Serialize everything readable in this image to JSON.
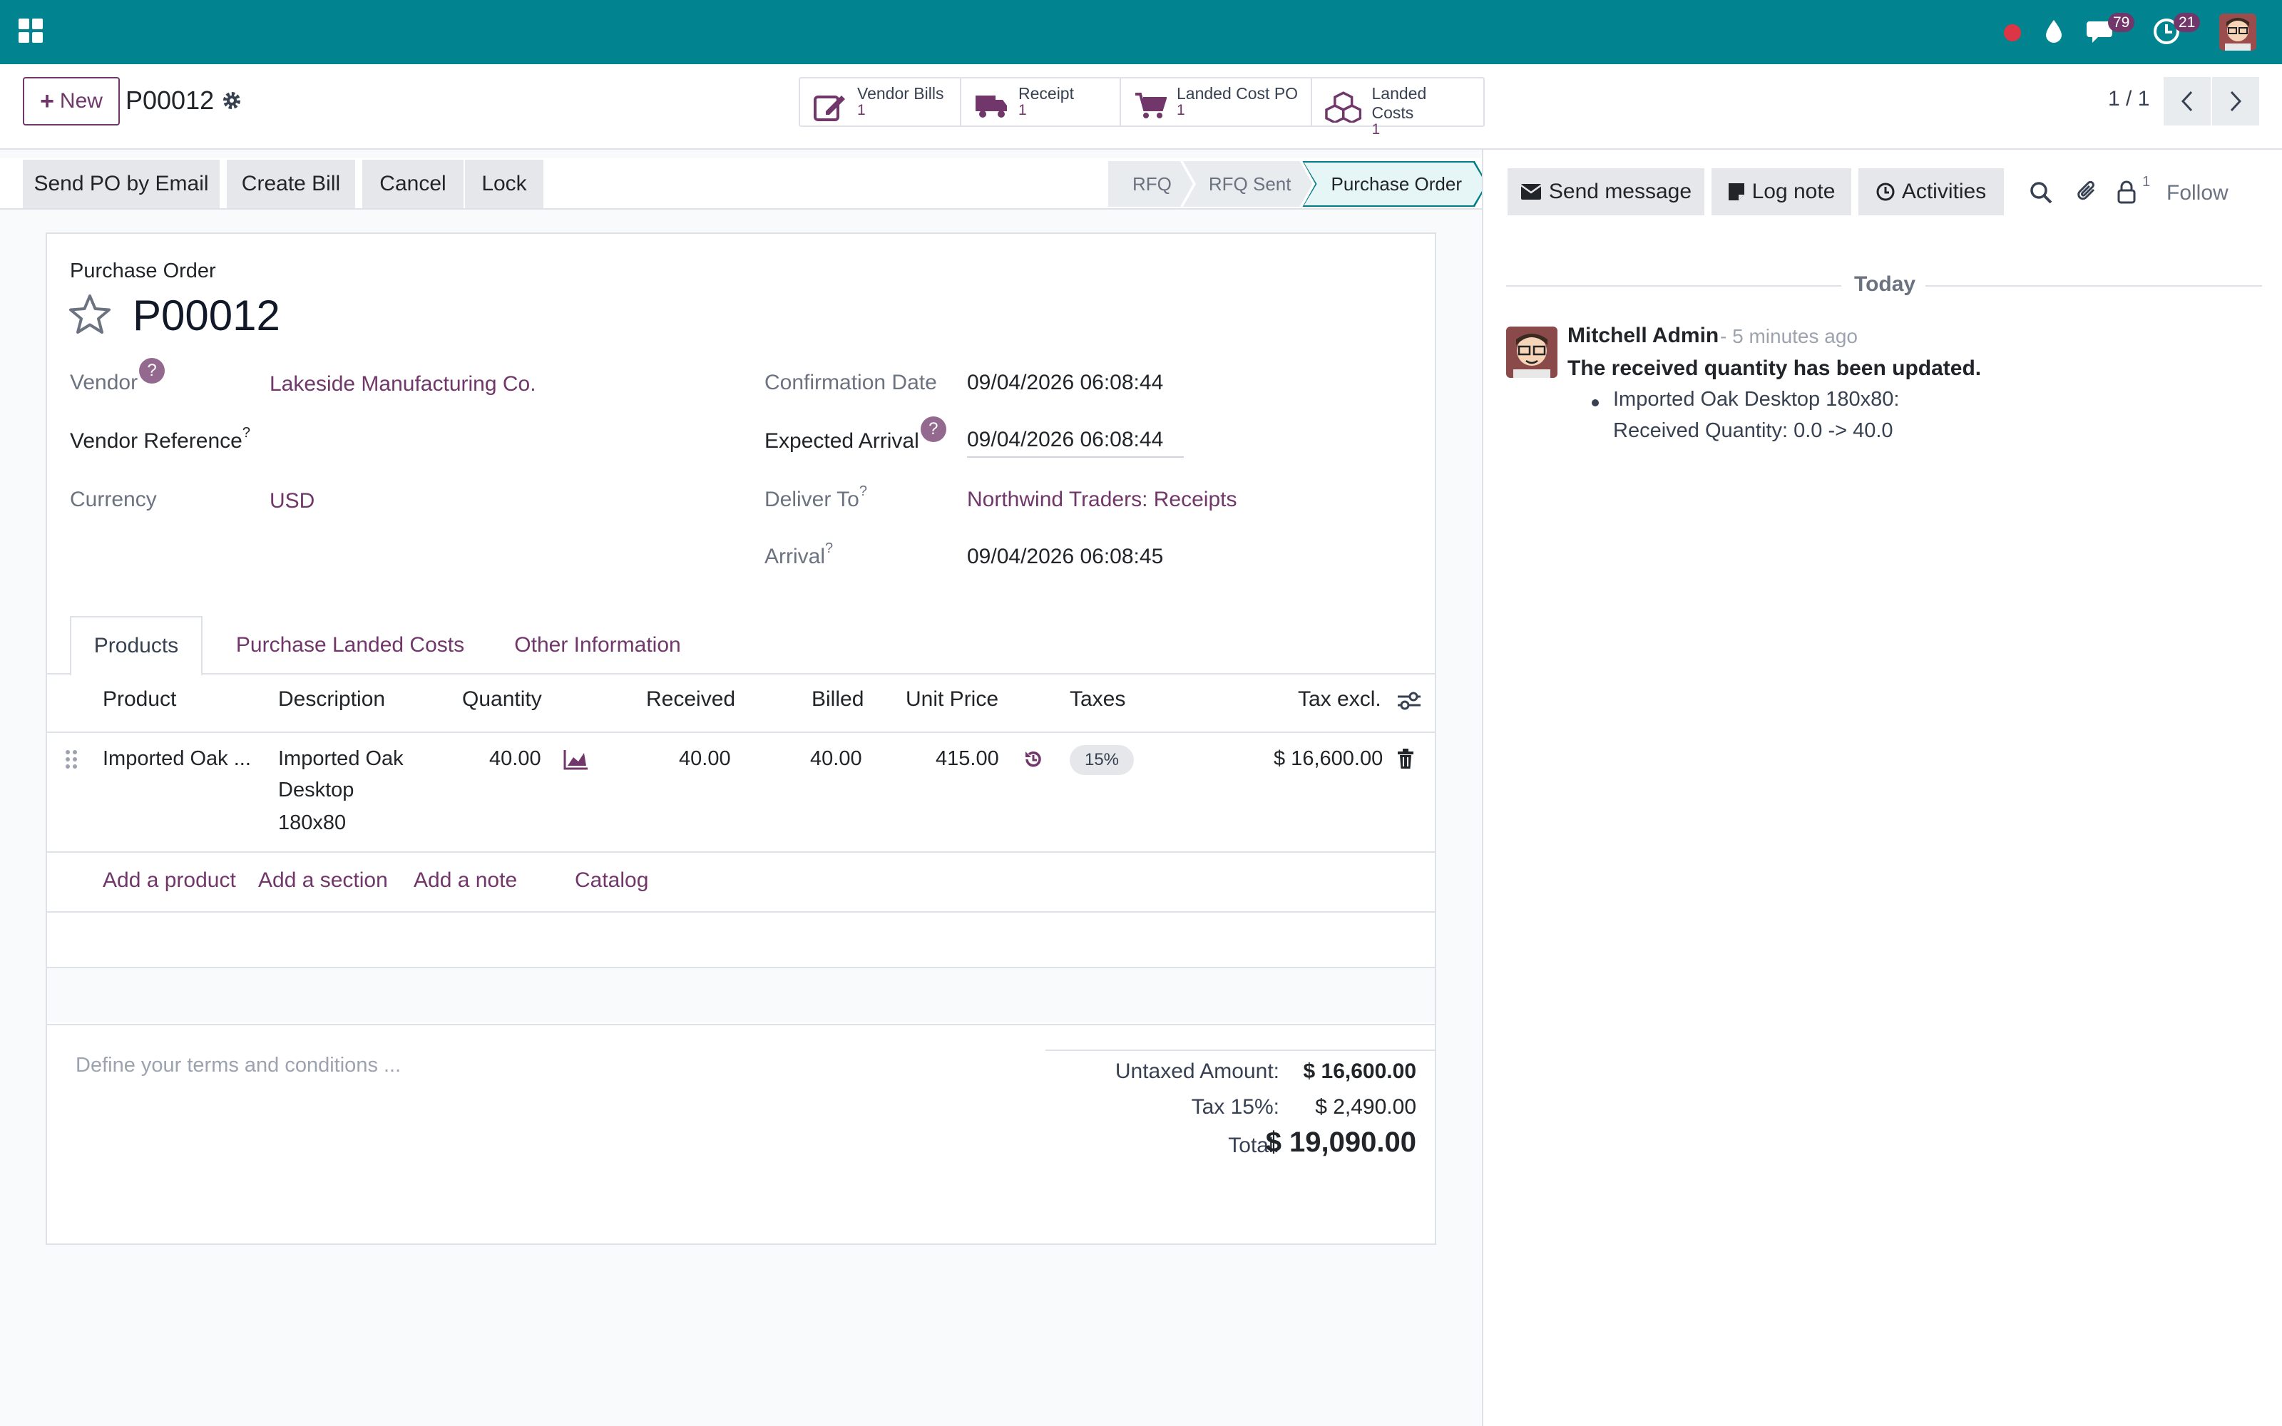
{
  "navbar": {
    "messages_count": "79",
    "activities_count": "21",
    "accent_color": "#01848f"
  },
  "control": {
    "new_label": "New",
    "record_name": "P00012",
    "pager": "1 / 1",
    "smart_buttons": [
      {
        "label": "Vendor Bills",
        "count": "1",
        "icon": "pencil-square-icon"
      },
      {
        "label": "Receipt",
        "count": "1",
        "icon": "truck-icon"
      },
      {
        "label": "Landed Cost PO",
        "count": "1",
        "icon": "shopping-cart-icon"
      },
      {
        "label": "Landed Costs",
        "count": "1",
        "icon": "cubes-icon"
      }
    ]
  },
  "actions": {
    "send_po": "Send PO by Email",
    "create_bill": "Create Bill",
    "cancel": "Cancel",
    "lock": "Lock"
  },
  "stages": [
    "RFQ",
    "RFQ Sent",
    "Purchase Order"
  ],
  "form": {
    "doc_type": "Purchase Order",
    "name": "P00012",
    "vendor_label": "Vendor",
    "vendor": "Lakeside Manufacturing Co.",
    "vendor_ref_label": "Vendor Reference",
    "currency_label": "Currency",
    "currency": "USD",
    "confirmation_date_label": "Confirmation Date",
    "confirmation_date": "09/04/2026 06:08:44",
    "expected_arrival_label": "Expected Arrival",
    "expected_arrival": "09/04/2026 06:08:44",
    "deliver_to_label": "Deliver To",
    "deliver_to": "Northwind Traders: Receipts",
    "arrival_label": "Arrival",
    "arrival": "09/04/2026 06:08:45",
    "help_mark": "?"
  },
  "tabs": [
    "Products",
    "Purchase Landed Costs",
    "Other Information"
  ],
  "lines": {
    "headers": {
      "product": "Product",
      "description": "Description",
      "quantity": "Quantity",
      "received": "Received",
      "billed": "Billed",
      "unit_price": "Unit Price",
      "taxes": "Taxes",
      "tax_excl": "Tax excl."
    },
    "rows": [
      {
        "product": "Imported Oak ...",
        "description_1": "Imported Oak",
        "description_2": "Desktop",
        "description_3": "180x80",
        "quantity": "40.00",
        "received": "40.00",
        "billed": "40.00",
        "unit_price": "415.00",
        "tax": "15%",
        "subtotal": "$ 16,600.00"
      }
    ],
    "add_product": "Add a product",
    "add_section": "Add a section",
    "add_note": "Add a note",
    "catalog": "Catalog"
  },
  "terms_placeholder": "Define your terms and conditions ...",
  "totals": {
    "untaxed_label": "Untaxed Amount:",
    "untaxed": "$ 16,600.00",
    "tax_label": "Tax 15%:",
    "tax": "$ 2,490.00",
    "total_label": "Total:",
    "total": "$ 19,090.00"
  },
  "chatter": {
    "send_message": "Send message",
    "log_note": "Log note",
    "activities": "Activities",
    "followers_count": "1",
    "follow": "Follow",
    "today": "Today",
    "message": {
      "author": "Mitchell Admin",
      "time": "- 5 minutes ago",
      "body": "The received quantity has been updated.",
      "item_line1": "Imported Oak Desktop 180x80:",
      "item_line2": "Received Quantity: 0.0 -> 40.0"
    }
  }
}
